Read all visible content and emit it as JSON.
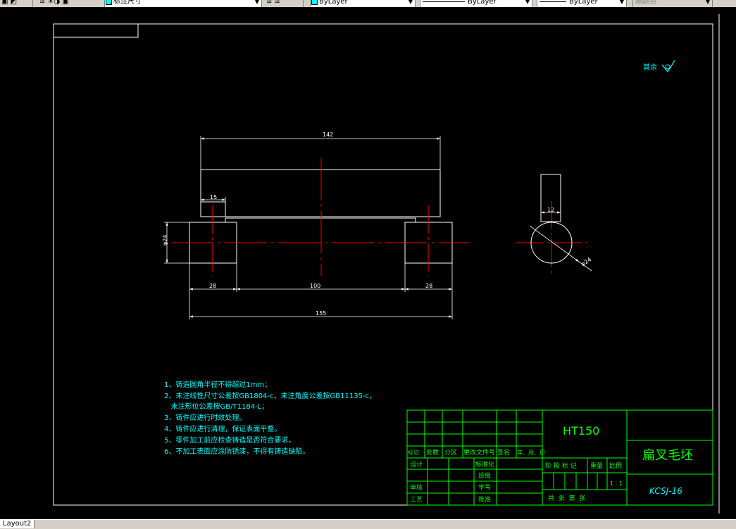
{
  "toolbar": {
    "dimstyle": "标注尺寸",
    "layer": "ByLayer",
    "linetype": "ByLayer",
    "lineweight": "ByLayer",
    "plotstyle": "随颜色"
  },
  "drawing": {
    "dims": {
      "overall_top": "142",
      "step": "15",
      "dia_left": "φ24",
      "left_boss": "28",
      "center": "100",
      "right_boss": "28",
      "overall_bottom": "155",
      "side_width": "12",
      "side_dia": "φ24"
    },
    "roughness_label": "其余",
    "notes": [
      "1、铸造圆角半径不得超过1mm；",
      "2、未注线性尺寸公差按GB1804-c，未注角度公差按GB11135-c，",
      "   未注形位公差按GB/T1184-L；",
      "3、铸件应进行时效处理。",
      "4、铸件应进行清理，保证表面平整。",
      "5、零件加工前应检查铸造是否符合要求。",
      "6、不加工表面应涂防锈漆，不得有铸造缺陷。"
    ]
  },
  "title_block": {
    "row_labels": [
      "标记",
      "处数",
      "分区",
      "更改文件号",
      "签名",
      "年、月、日"
    ],
    "design": "设计",
    "standardize": "标准化",
    "class": "班级",
    "review": "审核",
    "student_no": "学号",
    "process": "工艺",
    "approve": "批准",
    "material": "HT150",
    "stage_labels": [
      "阶 段 标 记",
      "重量",
      "比例"
    ],
    "scale": "1 : 1",
    "sheet_info": "共  张  第  张",
    "part_name": "扁叉毛坯",
    "drawing_no": "KCSJ-16"
  },
  "status": {
    "layout_tab": "Layout2"
  }
}
